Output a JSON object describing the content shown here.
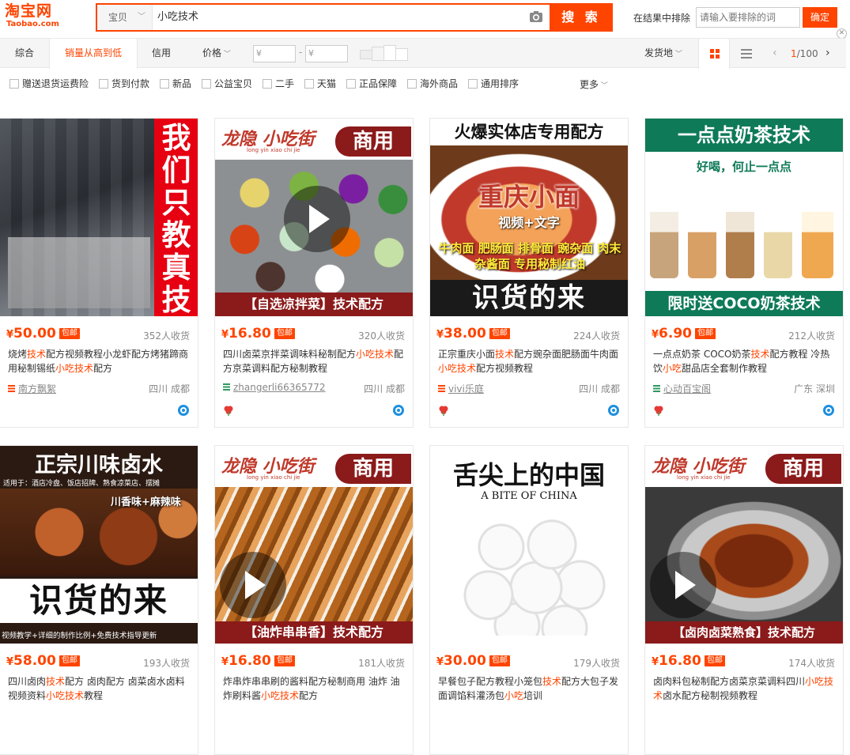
{
  "header": {
    "logo_main": "淘宝网",
    "logo_sub": "Taobao.com",
    "search_category": "宝贝",
    "search_value": "小吃技术",
    "search_button": "搜 索",
    "exclude_label": "在结果中排除",
    "exclude_placeholder": "请输入要排除的词",
    "exclude_button": "确定",
    "close": "✕"
  },
  "sortbar": {
    "tabs": [
      "综合",
      "销量从高到低",
      "信用",
      "价格"
    ],
    "active_tab": "销量从高到低",
    "price_min_placeholder": "¥",
    "price_max_placeholder": "¥",
    "price_dash": "-",
    "ship_from": "发货地",
    "pager_current": "1",
    "pager_total": "/100"
  },
  "filters": [
    "赠送退货运费险",
    "货到付款",
    "新品",
    "公益宝贝",
    "二手",
    "天猫",
    "正品保障",
    "海外商品",
    "通用排序"
  ],
  "filters_more": "更多",
  "products": [
    {
      "price": "50.00",
      "badge": "包邮",
      "sales": "352人收货",
      "title_parts": [
        "烧烤",
        "技术",
        "配方视频教程小龙虾配方烤猪蹄商用秘制锡纸",
        "小吃技术",
        "配方"
      ],
      "shop": "南方飘絮",
      "location": "四川 成都",
      "image_text": "我们只教真技术"
    },
    {
      "price": "16.80",
      "badge": "包邮",
      "sales": "320人收货",
      "title_parts": [
        "四川卤菜京拌菜调味料秘制配方",
        "小吃技术",
        "配方京菜调料配方秘制教程"
      ],
      "shop": "zhangerli66365772",
      "location": "四川 成都",
      "image_brand": "龙隐 小吃街",
      "image_brand_sub": "long yin xiao chi jie",
      "image_tag": "商用",
      "image_caption": "【自选凉拌菜】技术配方"
    },
    {
      "price": "38.00",
      "badge": "包邮",
      "sales": "224人收货",
      "title_parts": [
        "正宗重庆小面",
        "技术",
        "配方豌杂面肥肠面牛肉面",
        "小吃技术",
        "配方视频教程"
      ],
      "shop": "vivi乐庭",
      "location": "四川 成都",
      "image_top": "火爆实体店专用配方",
      "image_main": "重庆小面",
      "image_sub": "视频+文字",
      "image_items": "牛肉面 肥肠面 排骨面 豌杂面 肉末杂酱面 专用秘制红油",
      "image_bottom": "识货的来"
    },
    {
      "price": "6.90",
      "badge": "包邮",
      "sales": "212人收货",
      "title_parts": [
        "一点点奶茶 COCO奶茶",
        "技术",
        "配方教程 冷热饮",
        "小吃",
        "甜品店全套制作教程"
      ],
      "shop": "心动百宝阁",
      "location": "广东 深圳",
      "image_top": "一点点奶茶技术",
      "image_slogan": "好喝，何止一点点",
      "image_bottom": "限时送COCO奶茶技术"
    },
    {
      "price": "58.00",
      "badge": "包邮",
      "sales": "193人收货",
      "title_parts": [
        "四川卤肉",
        "技术",
        "配方 卤肉配方 卤菜卤水卤料视频资料",
        "小吃技术",
        "教程"
      ],
      "image_top": "正宗川味卤水",
      "image_sub": "适用于：酒店冷盘、饭店招牌、熟食凉菜店、摆摊",
      "image_tag": "川香味+麻辣味",
      "image_bottom": "识货的来",
      "image_footer": "视频教学+详细的制作比例+免费技术指导更新"
    },
    {
      "price": "16.80",
      "badge": "包邮",
      "sales": "181人收货",
      "title_parts": [
        "炸串炸串串刷的酱料配方秘制商用 油炸 油炸刷料酱",
        "小吃技术",
        "配方"
      ],
      "image_brand": "龙隐 小吃街",
      "image_brand_sub": "long yin xiao chi jie",
      "image_tag": "商用",
      "image_caption": "【油炸串串香】技术配方"
    },
    {
      "price": "30.00",
      "badge": "包邮",
      "sales": "179人收货",
      "title_parts": [
        "早餐包子配方教程小笼包",
        "技术",
        "配方大包子发面调馅料灌汤包",
        "小吃",
        "培训"
      ],
      "image_top": "舌尖上的中国",
      "image_sub": "A BITE OF CHINA"
    },
    {
      "price": "16.80",
      "badge": "包邮",
      "sales": "174人收货",
      "title_parts": [
        "卤肉料包秘制配方卤菜京菜调料四川",
        "小吃技术",
        "卤水配方秘制视频教程"
      ],
      "image_brand": "龙隐 小吃街",
      "image_brand_sub": "long yin xiao chi jie",
      "image_tag": "商用",
      "image_caption": "【卤肉卤菜熟食】技术配方"
    }
  ],
  "colors": {
    "accent": "#ff4400",
    "dark_red": "#8b1a1a",
    "tea_green": "#0e7a57"
  }
}
